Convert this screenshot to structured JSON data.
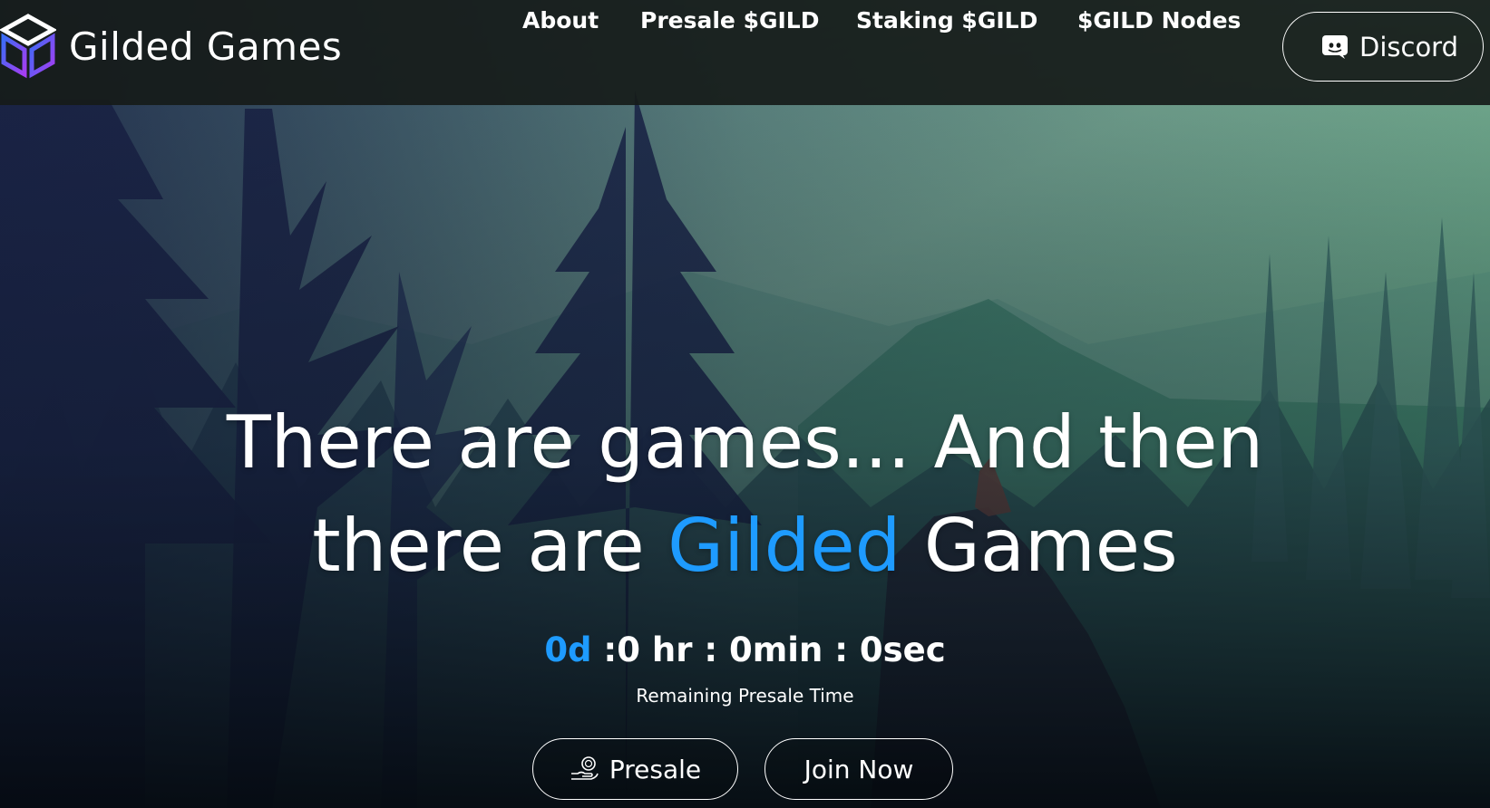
{
  "brand": {
    "name": "Gilded Games",
    "logo_icon": "cube-logo-icon"
  },
  "nav": {
    "items": [
      {
        "label": "About"
      },
      {
        "label": "Presale $GILD"
      },
      {
        "label": "Staking $GILD"
      },
      {
        "label": "$GILD Nodes"
      }
    ],
    "discord": {
      "label": "Discord",
      "icon": "discord-icon"
    }
  },
  "hero": {
    "title_line1": "There are games... And then",
    "title_line2_prefix": "there are ",
    "title_line2_accent": "Gilded",
    "title_line2_suffix": " Games"
  },
  "countdown": {
    "days": "0d",
    "rest": " :0 hr : 0min : 0sec",
    "caption": "Remaining Presale Time"
  },
  "buttons": {
    "presale_label": "Presale",
    "presale_icon": "coin-hand-icon",
    "join_label": "Join Now"
  },
  "colors": {
    "accent": "#1e9bff",
    "header_bg": "#161b19",
    "logo_gradient_start": "#3b6cf6",
    "logo_gradient_end": "#a63df2"
  }
}
